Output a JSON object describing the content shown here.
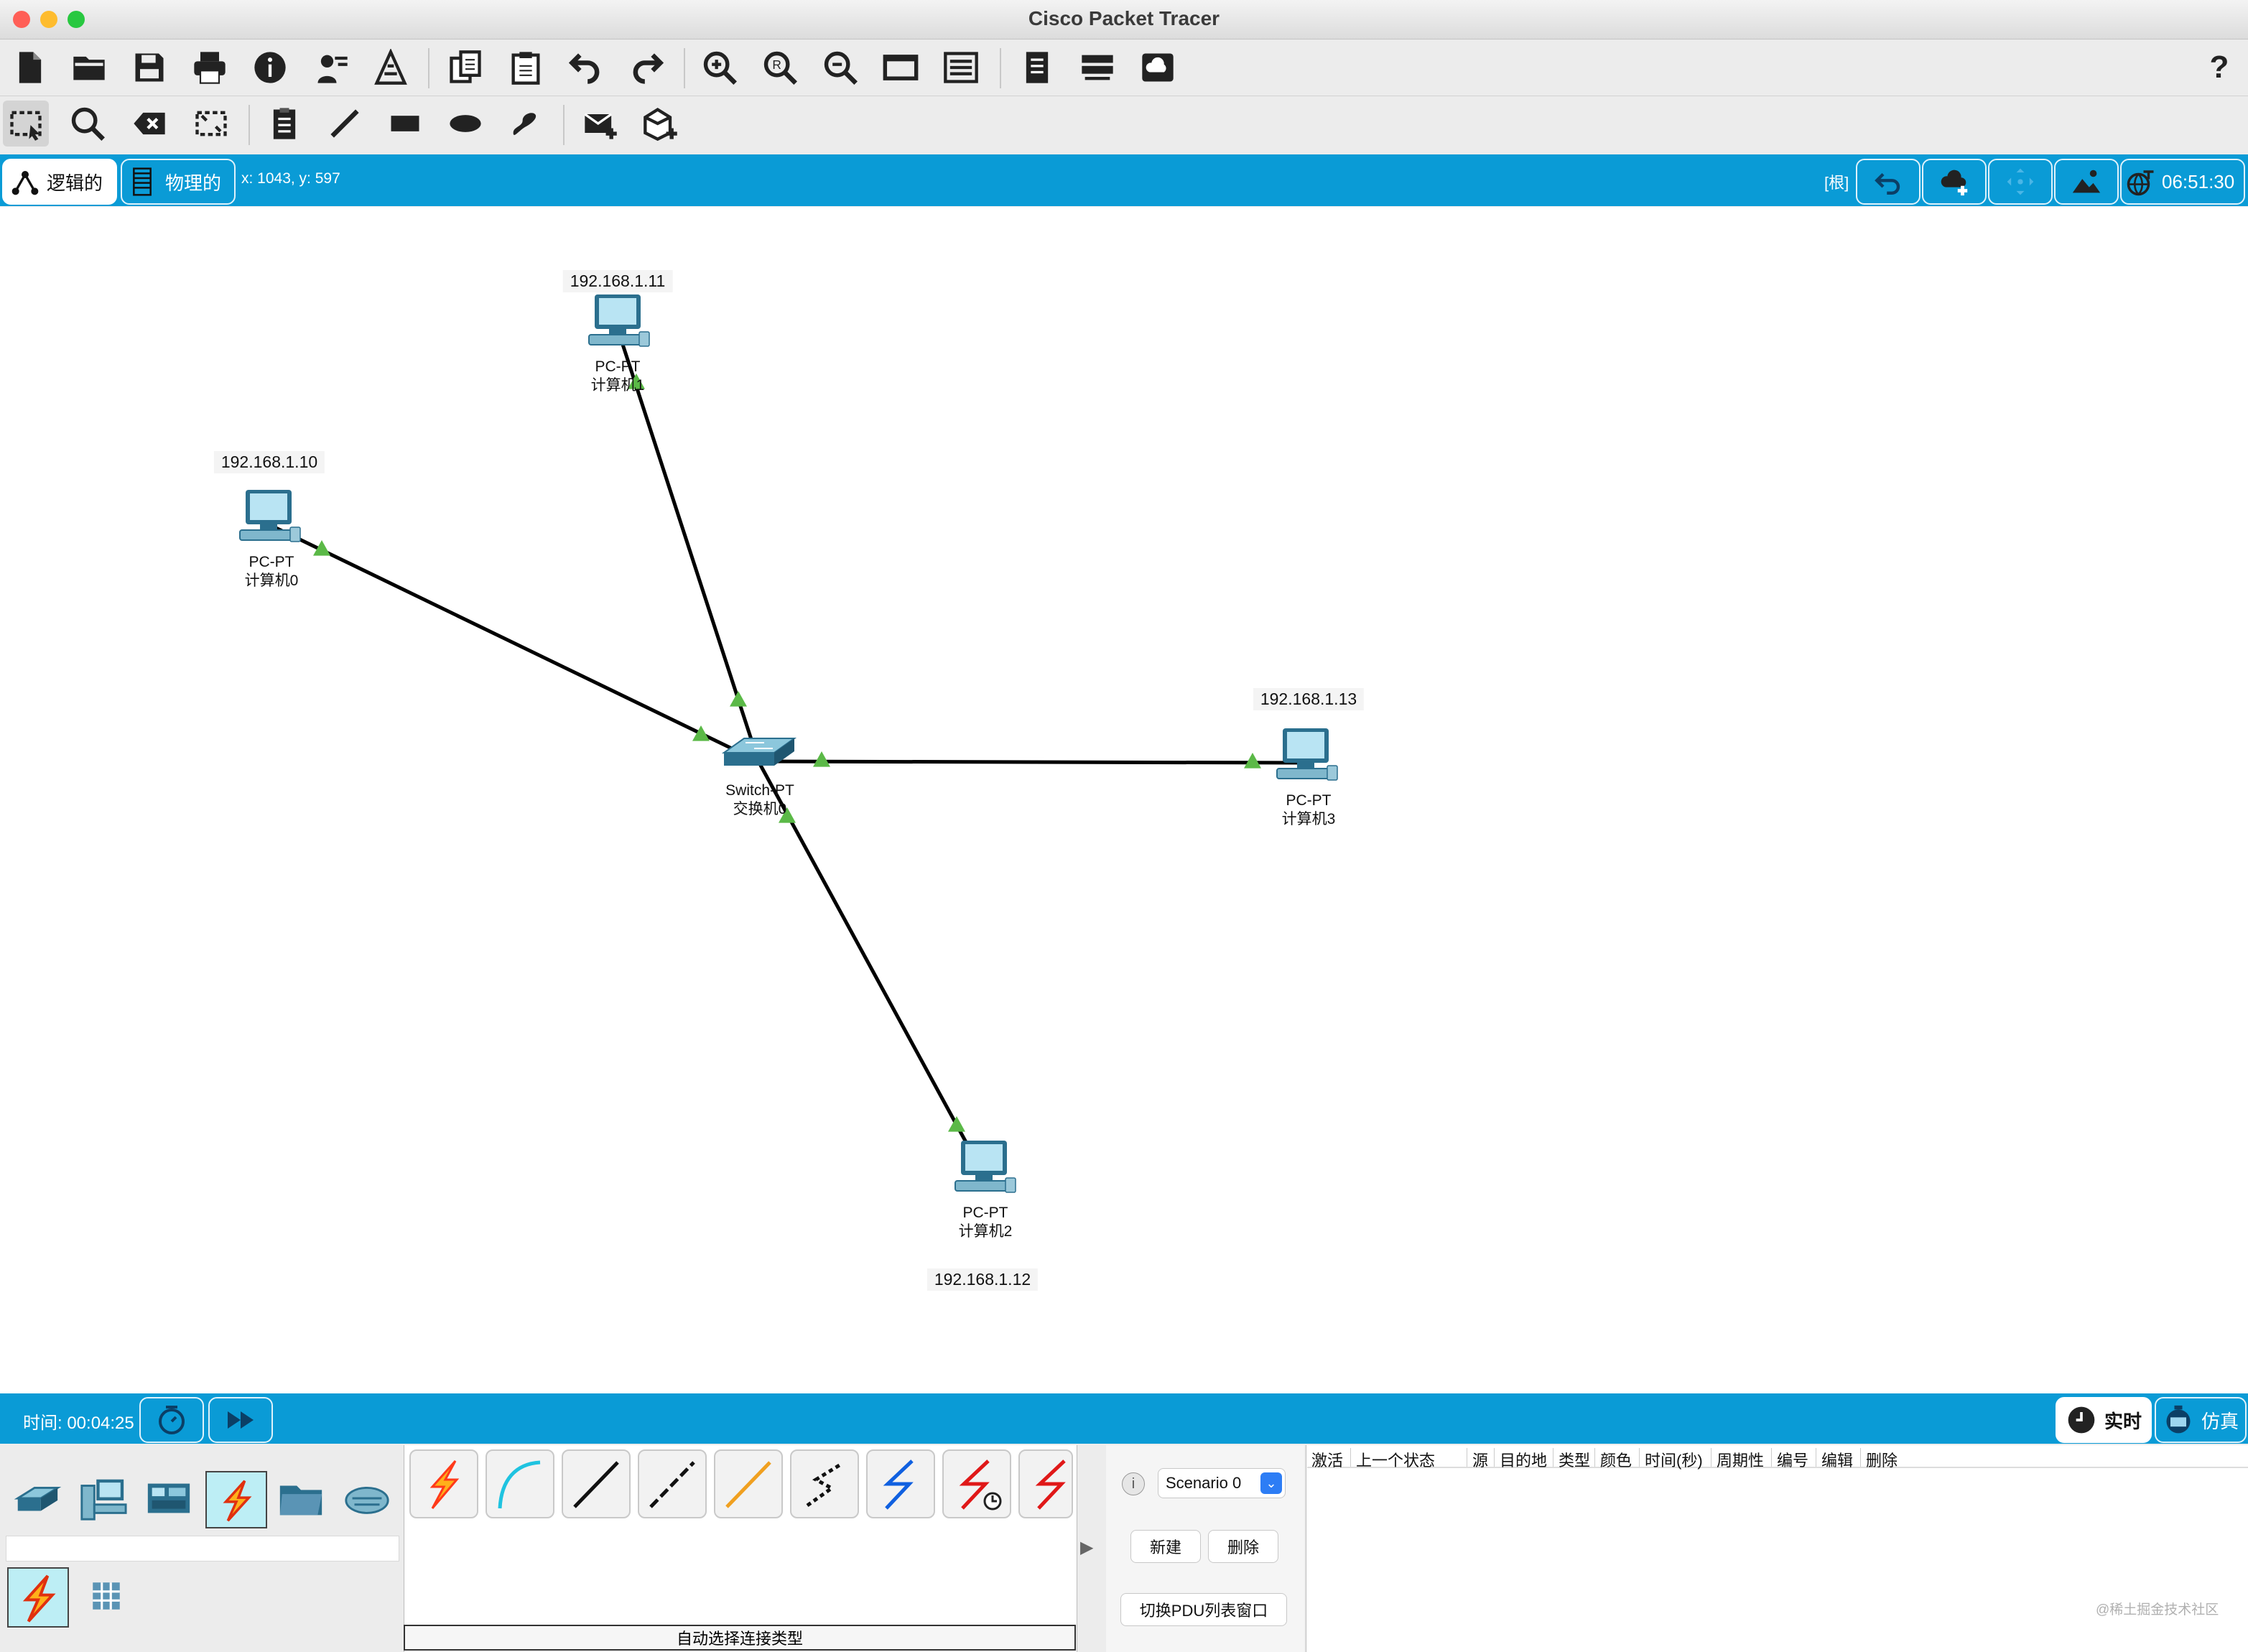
{
  "window": {
    "title": "Cisco Packet Tracer"
  },
  "colors": {
    "accent_blue": "#0a9bd6",
    "link_line": "#000000",
    "link_up": "#5bb947",
    "traffic_red": "#ff5f57",
    "traffic_yellow": "#febc2e",
    "traffic_green": "#28c840"
  },
  "toolbar_main": {
    "icons": [
      "new-file-icon",
      "open-folder-icon",
      "save-icon",
      "print-icon",
      "info-icon",
      "activity-wizard-icon",
      "custom-device-icon",
      "copy-icon",
      "paste-icon",
      "undo-icon",
      "redo-icon",
      "zoom-in-icon",
      "zoom-reset-icon",
      "zoom-out-icon",
      "drawing-palette-icon",
      "custom-device-dialog-icon",
      "view-command-log-icon",
      "network-info-icon",
      "cloud-icon"
    ],
    "help_label": "?"
  },
  "toolbar_tools": {
    "icons": [
      "select-icon",
      "inspect-icon",
      "delete-icon",
      "resize-icon",
      "note-icon",
      "line-icon",
      "rectangle-icon",
      "ellipse-icon",
      "freeform-icon",
      "add-simple-pdu-icon",
      "add-complex-pdu-icon"
    ]
  },
  "viewbar": {
    "logical_label": "逻辑的",
    "physical_label": "物理的",
    "coords": "x: 1043, y: 597",
    "root_label": "[根]",
    "clock": "06:51:30"
  },
  "topology": {
    "devices": [
      {
        "id": "pc1",
        "type": "PC-PT",
        "name": "计算机1",
        "ip": "192.168.1.11"
      },
      {
        "id": "pc0",
        "type": "PC-PT",
        "name": "计算机0",
        "ip": "192.168.1.10"
      },
      {
        "id": "switch0",
        "type": "Switch-PT",
        "name": "交换机0",
        "ip": ""
      },
      {
        "id": "pc3",
        "type": "PC-PT",
        "name": "计算机3",
        "ip": "192.168.1.13"
      },
      {
        "id": "pc2",
        "type": "PC-PT",
        "name": "计算机2",
        "ip": "192.168.1.12"
      }
    ],
    "links": [
      {
        "from": "switch0",
        "to": "pc1",
        "status": "up"
      },
      {
        "from": "switch0",
        "to": "pc0",
        "status": "up"
      },
      {
        "from": "switch0",
        "to": "pc3",
        "status": "up"
      },
      {
        "from": "switch0",
        "to": "pc2",
        "status": "up"
      }
    ]
  },
  "statusbar": {
    "time_label": "时间: 00:04:25",
    "realtime_label": "实时",
    "simulation_label": "仿真"
  },
  "device_categories": [
    "network-devices-icon",
    "end-devices-icon",
    "components-icon",
    "connections-icon",
    "misc-folder-icon",
    "multiuser-cloud-icon"
  ],
  "subcategories": [
    "connections-sub-icon",
    "grid-icon"
  ],
  "cables": [
    {
      "name": "automatic-cable-icon",
      "color": "#ff3a1a"
    },
    {
      "name": "console-cable-icon",
      "color": "#1fc3e0"
    },
    {
      "name": "copper-straight-cable-icon",
      "color": "#111111"
    },
    {
      "name": "copper-cross-cable-icon",
      "color": "#111111"
    },
    {
      "name": "fiber-cable-icon",
      "color": "#f0a020"
    },
    {
      "name": "phone-cable-icon",
      "color": "#111111"
    },
    {
      "name": "coaxial-cable-icon",
      "color": "#1060e0"
    },
    {
      "name": "serial-dce-cable-icon",
      "color": "#e01818"
    },
    {
      "name": "serial-dte-cable-icon",
      "color": "#e01818"
    }
  ],
  "cable_panel": {
    "auto_label": "自动选择连接类型"
  },
  "scenario": {
    "selected": "Scenario 0",
    "new_label": "新建",
    "delete_label": "删除",
    "toggle_label": "切换PDU列表窗口"
  },
  "pdu_table": {
    "columns": [
      "激活",
      "上一个状态",
      "源",
      "目的地",
      "类型",
      "颜色",
      "时间(秒)",
      "周期性",
      "编号",
      "编辑",
      "删除"
    ]
  },
  "watermark": "@稀土掘金技术社区"
}
